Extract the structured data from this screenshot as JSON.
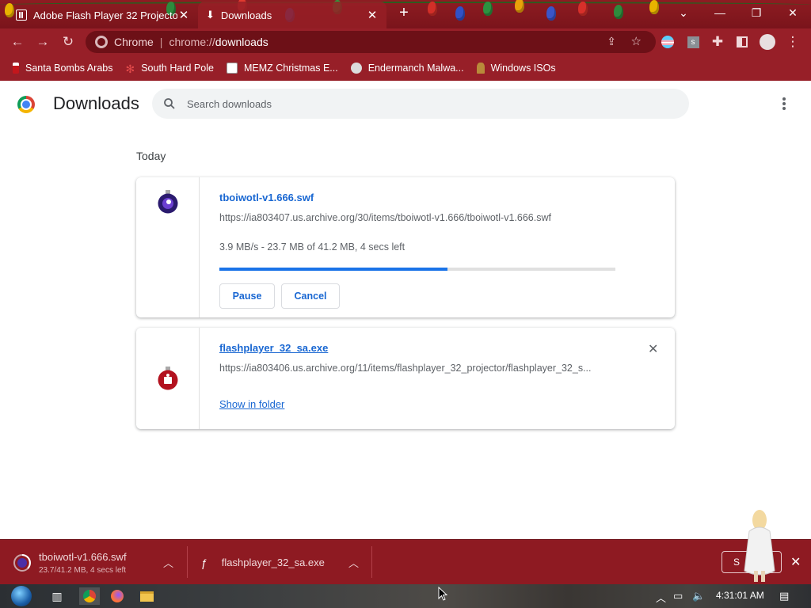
{
  "tabs": [
    {
      "title": "Adobe Flash Player 32 Projector",
      "icon": "page-icon",
      "active": false
    },
    {
      "title": "Downloads",
      "icon": "download-icon",
      "active": true
    }
  ],
  "window_controls": {
    "minimize": "—",
    "restore": "❐",
    "close": "✕"
  },
  "omnibox": {
    "scheme_label": "Chrome",
    "url_prefix": "chrome://",
    "url_host": "downloads"
  },
  "bookmarks": [
    {
      "label": "Santa Bombs Arabs",
      "icon": "santa-icon"
    },
    {
      "label": "South Hard Pole",
      "icon": "snowflake-icon"
    },
    {
      "label": "MEMZ Christmas E...",
      "icon": "memz-icon"
    },
    {
      "label": "Endermanch Malwa...",
      "icon": "raccoon-icon"
    },
    {
      "label": "Windows ISOs",
      "icon": "figure-icon"
    }
  ],
  "header": {
    "title": "Downloads",
    "search_placeholder": "Search downloads"
  },
  "section": {
    "heading": "Today"
  },
  "downloads": [
    {
      "filename": "tboiwotl-v1.666.swf",
      "url": "https://ia803407.us.archive.org/30/items/tboiwotl-v1.666/tboiwotl-v1.666.swf",
      "status": "3.9 MB/s - 23.7 MB of 41.2 MB, 4 secs left",
      "progress_percent": 57.5,
      "pause_label": "Pause",
      "cancel_label": "Cancel"
    },
    {
      "filename": "flashplayer_32_sa.exe",
      "url": "https://ia803406.us.archive.org/11/items/flashplayer_32_projector/flashplayer_32_s...",
      "show_in_folder_label": "Show in folder",
      "remove_label": "✕"
    }
  ],
  "shelf": {
    "items": [
      {
        "name": "tboiwotl-v1.666.swf",
        "sub": "23.7/41.2 MB, 4 secs left"
      },
      {
        "name": "flashplayer_32_sa.exe"
      }
    ],
    "show_all_label": "S",
    "close_label": "✕"
  },
  "taskbar": {
    "clock": "4:31:01 AM"
  },
  "colors": {
    "accent": "#1a73e8",
    "link": "#1967d2",
    "toolbar": "#971f28",
    "shelf": "#8e1a22"
  }
}
